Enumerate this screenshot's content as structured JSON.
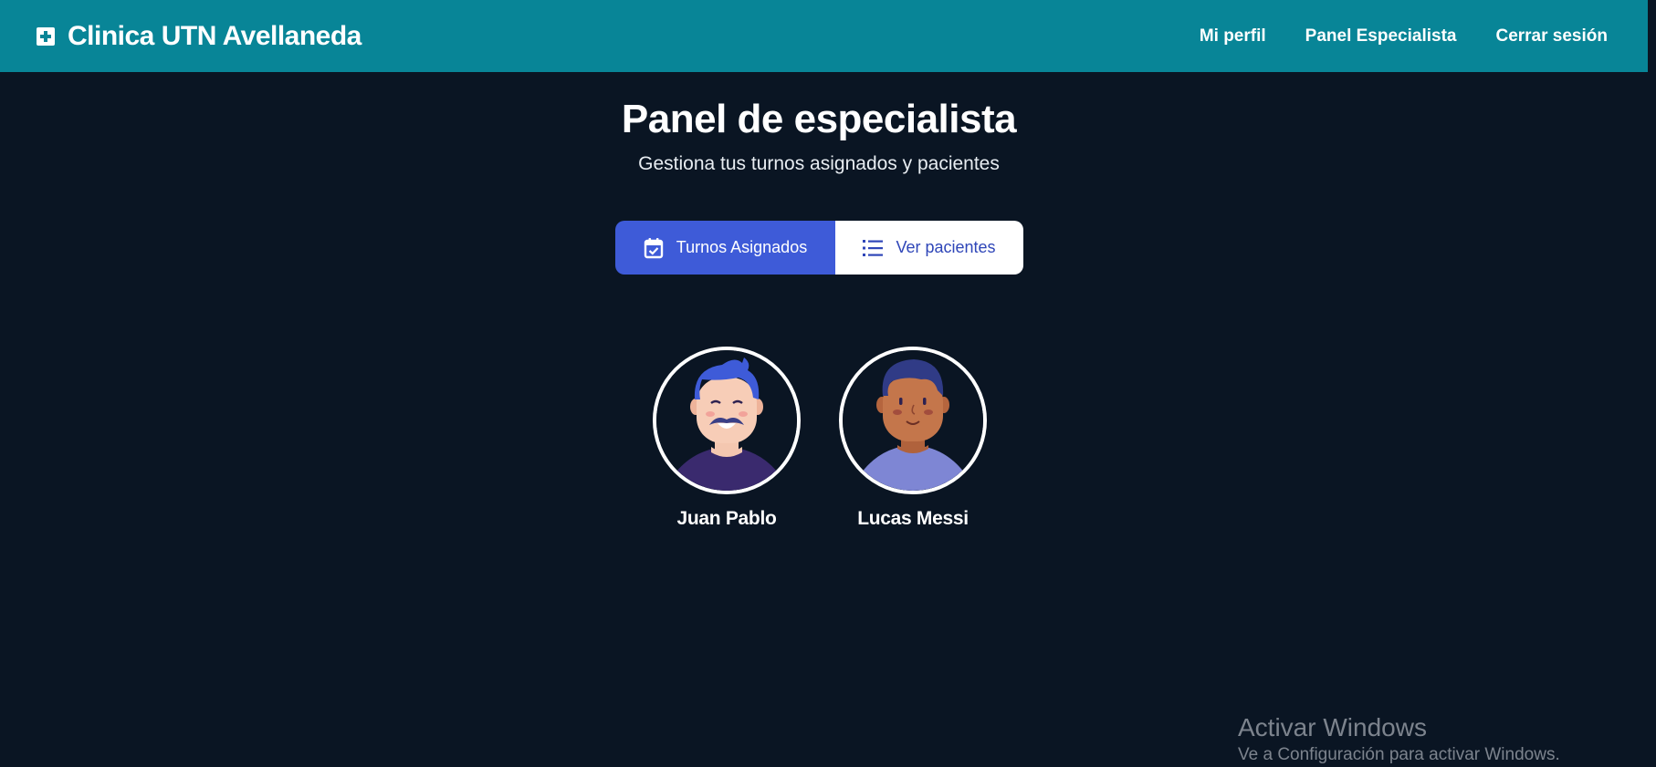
{
  "navbar": {
    "brand_icon": "medical-cross-icon",
    "brand_title": "Clinica UTN Avellaneda",
    "links": [
      "Mi perfil",
      "Panel Especialista",
      "Cerrar sesión"
    ],
    "background_color": "#088597"
  },
  "header": {
    "title": "Panel de especialista",
    "subtitle": "Gestiona tus turnos asignados y pacientes"
  },
  "tabs": [
    {
      "label": "Turnos Asignados",
      "icon": "calendar-check-icon",
      "active": true
    },
    {
      "label": "Ver pacientes",
      "icon": "list-icon",
      "active": false
    }
  ],
  "patients": [
    {
      "name": "Juan Pablo",
      "avatar": "man-blue-hair-mustache-avatar"
    },
    {
      "name": "Lucas Messi",
      "avatar": "man-dark-skin-avatar"
    }
  ],
  "watermark": {
    "title": "Activar Windows",
    "subtitle": "Ve a Configuración para activar Windows."
  },
  "colors": {
    "page_background": "#0a1523",
    "tab_active": "#3e5bd8",
    "tab_inactive_text": "#2f46b8"
  }
}
